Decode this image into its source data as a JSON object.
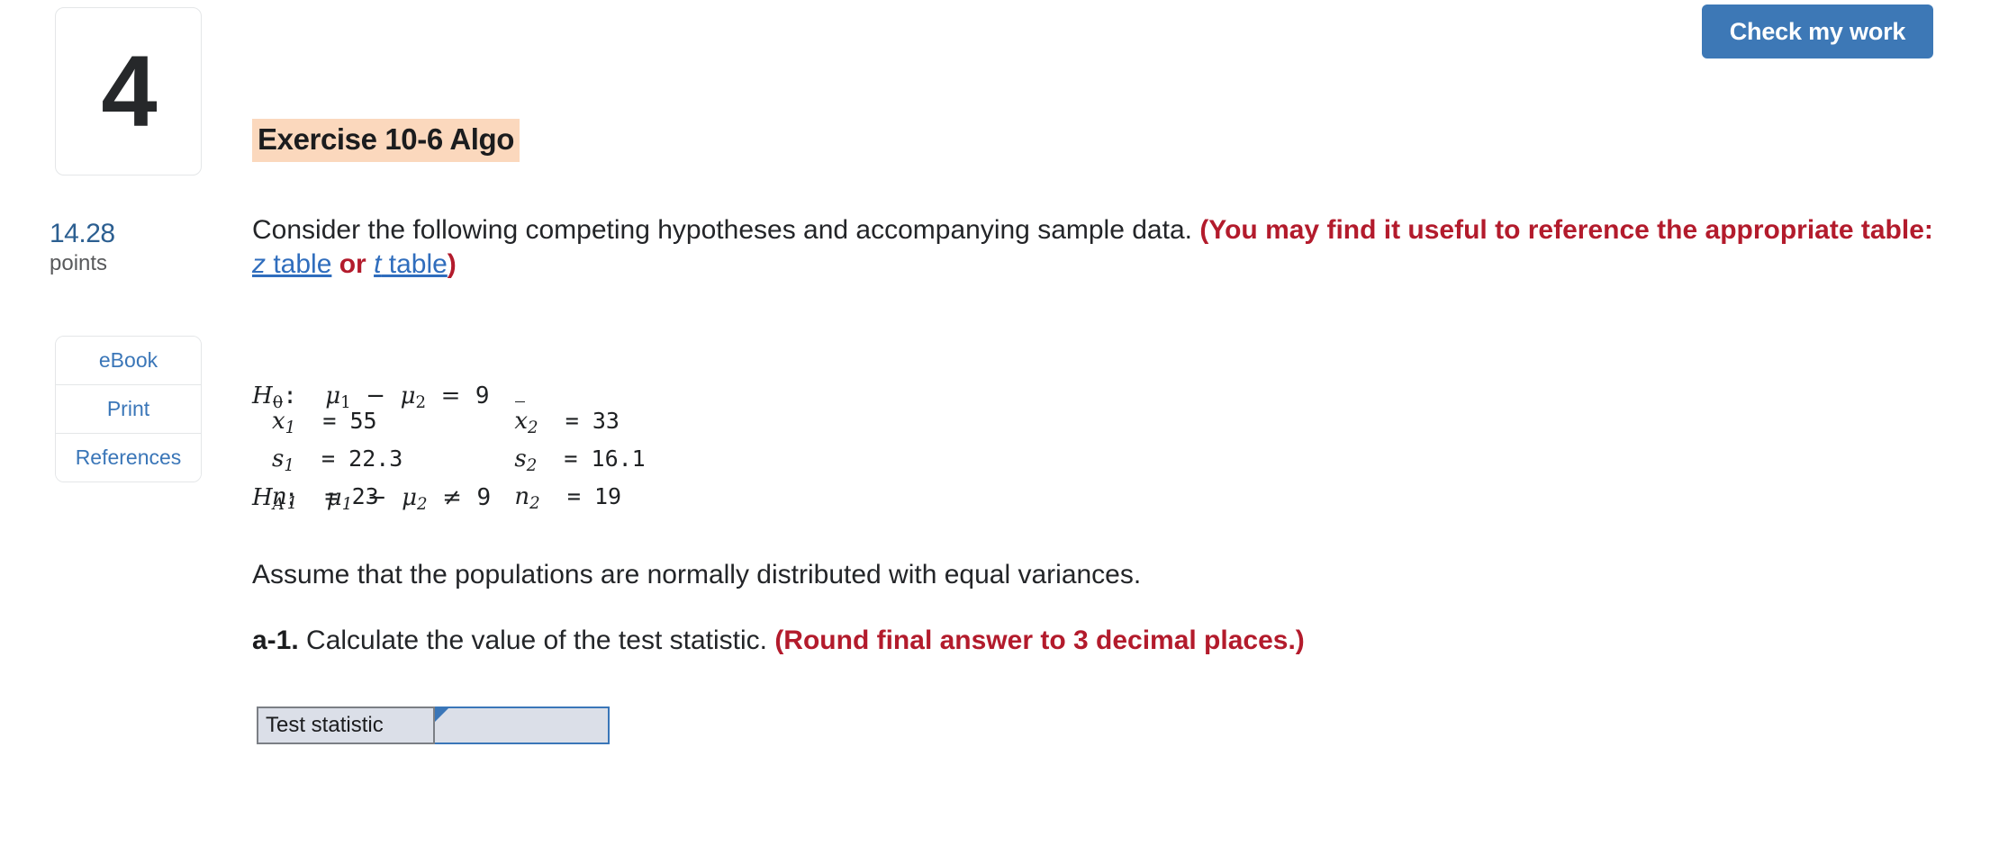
{
  "header": {
    "check_button_label": "Check my work",
    "check_button_color": "#3d78b6"
  },
  "rail": {
    "question_number": "4",
    "points_value": "14.28",
    "points_label": "points",
    "buttons": [
      {
        "label": "eBook",
        "name": "ebook"
      },
      {
        "label": "Print",
        "name": "print"
      },
      {
        "label": "References",
        "name": "references"
      }
    ],
    "link_color": "#3a76b8"
  },
  "exercise": {
    "title": "Exercise 10-6 Algo",
    "title_highlight_color": "#fbd8bd",
    "prompt_plain_1": "Consider the following competing hypotheses and accompanying sample data. ",
    "prompt_red_1": "(You may find it useful to reference the appropriate table: ",
    "link_z_italic": "z",
    "link_z_rest": " table",
    "prompt_red_or": " or ",
    "link_t_italic": "t",
    "link_t_rest": " table",
    "prompt_red_close": ")",
    "red_color": "#b31b2c"
  },
  "hypotheses": {
    "h0_label": "H",
    "h0_sub": "0",
    "h0_colon": ":  ",
    "h0_expr_mu1": "μ",
    "h0_expr_sub1": "1",
    "h0_minus": "  −  ",
    "h0_expr_mu2": "μ",
    "h0_expr_sub2": "2",
    "h0_operator": "  =  ",
    "h0_value": "9",
    "ha_label": "H",
    "ha_sub": "A",
    "ha_colon": ":  ",
    "ha_expr_mu1": "μ",
    "ha_expr_sub1": "1",
    "ha_minus": "  −  ",
    "ha_expr_mu2": "μ",
    "ha_expr_sub2": "2",
    "ha_operator": "  ≠  ",
    "ha_value": "9"
  },
  "sample_data": {
    "rows": [
      {
        "left_symbol": "x",
        "left_sub": "1",
        "left_bar": true,
        "left_eq": "=",
        "left_value": "55",
        "right_symbol": "x",
        "right_sub": "2",
        "right_bar": true,
        "right_eq": "=",
        "right_value": "33"
      },
      {
        "left_symbol": "s",
        "left_sub": "1",
        "left_bar": false,
        "left_eq": "=",
        "left_value": "22.3",
        "right_symbol": "s",
        "right_sub": "2",
        "right_bar": false,
        "right_eq": "=",
        "right_value": "16.1"
      },
      {
        "left_symbol": "n",
        "left_sub": "1",
        "left_bar": false,
        "left_eq": "=",
        "left_value": "23",
        "right_symbol": "n",
        "right_sub": "2",
        "right_bar": false,
        "right_eq": "=",
        "right_value": "19"
      }
    ]
  },
  "body": {
    "assumption": "Assume that the populations are normally distributed with equal variances.",
    "question_a1_tag": "a-1.",
    "question_a1_text": " Calculate the value of the test statistic. ",
    "question_a1_red": "(Round final answer to 3 decimal places.)"
  },
  "answer_table": {
    "row_label": "Test statistic",
    "input_value": "",
    "input_placeholder": "",
    "cell_fill_color": "#dbdfe8",
    "cell_border_color": "#3a76b8",
    "label_border_color": "#7b7f85"
  }
}
